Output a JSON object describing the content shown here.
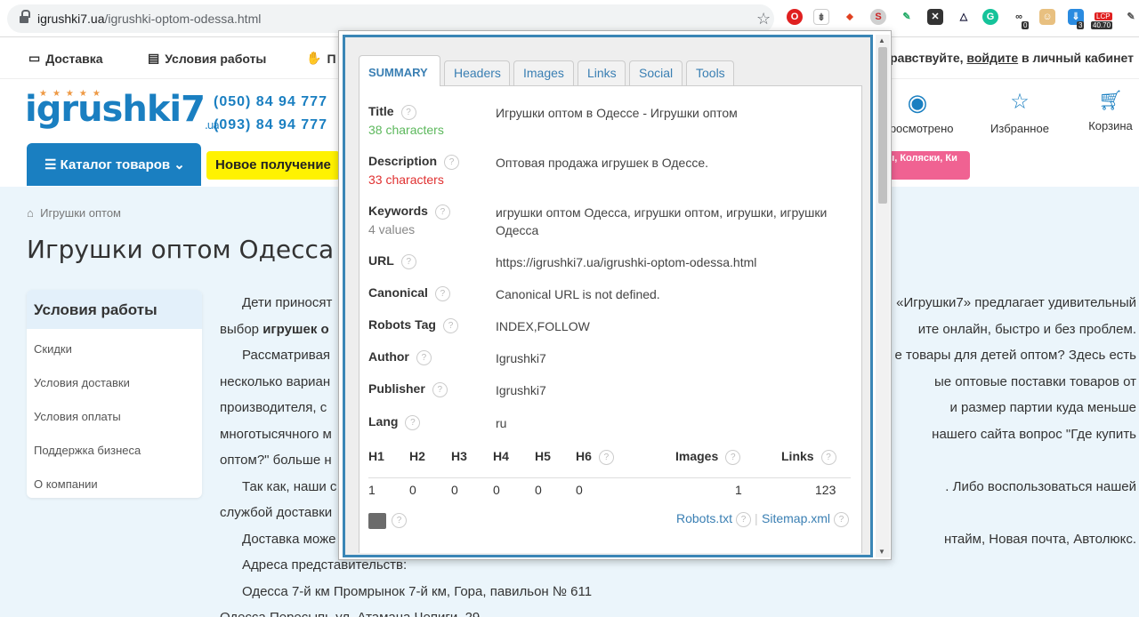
{
  "browser": {
    "url_domain": "igrushki7.ua",
    "url_path": "/igrushki-optom-odessa.html",
    "ext_badges": [
      "0",
      "3",
      "40.70"
    ],
    "ext_lcp": "LCP"
  },
  "site": {
    "top_links": [
      "Доставка",
      "Условия работы",
      "П"
    ],
    "greeting_pre": "Здравствуйте, ",
    "greeting_link": "войдите",
    "greeting_post": " в личный кабинет",
    "logo": "igrushki7",
    "logo_suffix": ".ua",
    "phones": [
      "(050) 84 94 777",
      "(093) 84 94 777"
    ],
    "nav": [
      "Просмотрено",
      "Избранное",
      "Корзина"
    ],
    "catalog_label": "Каталог товаров",
    "new_arrivals": "Новое получение",
    "pink_button": "Ды, Коляски, Ки"
  },
  "page": {
    "breadcrumb": "Игрушки оптом",
    "title": "Игрушки оптом Одесса",
    "sidebar_title": "Условия работы",
    "sidebar_items": [
      "Скидки",
      "Условия доставки",
      "Условия оплаты",
      "Поддержка бизнеса",
      "О компании"
    ],
    "article_lines": [
      {
        "left": "Дети приносят",
        "right": "«Игрушки7» предлагает удивительный"
      },
      {
        "left": "выбор ",
        "bold": "игрушек о",
        "right": "ите онлайн, быстро и без проблем."
      },
      {
        "left": "Рассматривая",
        "right": "е товары для детей оптом? Здесь есть"
      },
      {
        "left": "несколько вариан",
        "right": "ые оптовые поставки товаров от"
      },
      {
        "left": "производителя, с",
        "right": "и размер партии куда меньше"
      },
      {
        "left": "многотысячного м",
        "right": "нашего сайта вопрос \"Где купить"
      },
      {
        "left": "оптом?\" больше н",
        "right": ""
      },
      {
        "left": "Так как, наши с",
        "right": ". Либо воспользоваться нашей"
      },
      {
        "left": "службой доставки",
        "right": ""
      },
      {
        "left": "Доставка може",
        "right": "нтайм, Новая почта, Автолюкс."
      },
      {
        "left": "Адреса представительств:",
        "right": ""
      },
      {
        "left": "Одесса 7-й км Промрынок 7-й км, Гора, павильон № 611",
        "right": ""
      },
      {
        "left": "Одесса Пересыпь ул. Атамана Чепиги, 29",
        "right": ""
      }
    ]
  },
  "seo": {
    "tabs": [
      "SUMMARY",
      "Headers",
      "Images",
      "Links",
      "Social",
      "Tools"
    ],
    "title_label": "Title",
    "title_sub": "38 characters",
    "title_value": "Игрушки оптом в Одессе - Игрушки оптом",
    "desc_label": "Description",
    "desc_sub": "33 characters",
    "desc_value": "Оптовая продажа игрушек в Одессе.",
    "kw_label": "Keywords",
    "kw_sub": "4 values",
    "kw_value": "игрушки оптом Одесса, игрушки оптом, игрушки, игрушки Одесса",
    "url_label": "URL",
    "url_value": "https://igrushki7.ua/igrushki-optom-odessa.html",
    "canonical_label": "Canonical",
    "canonical_value": "Canonical URL is not defined.",
    "robots_label": "Robots Tag",
    "robots_value": "INDEX,FOLLOW",
    "author_label": "Author",
    "author_value": "Igrushki7",
    "publisher_label": "Publisher",
    "publisher_value": "Igrushki7",
    "lang_label": "Lang",
    "lang_value": "ru",
    "headings": [
      "H1",
      "H2",
      "H3",
      "H4",
      "H5",
      "H6"
    ],
    "heading_counts": [
      "1",
      "0",
      "0",
      "0",
      "0",
      "0"
    ],
    "images_label": "Images",
    "images_count": "1",
    "links_label": "Links",
    "links_count": "123",
    "robots_txt": "Robots.txt",
    "sitemap": "Sitemap.xml",
    "help_glyph": "?"
  },
  "colors": {
    "site_blue": "#1a7fc1",
    "popup_border": "#3b86b6",
    "ok_green": "#5cb85c",
    "warn_red": "#e03030"
  }
}
